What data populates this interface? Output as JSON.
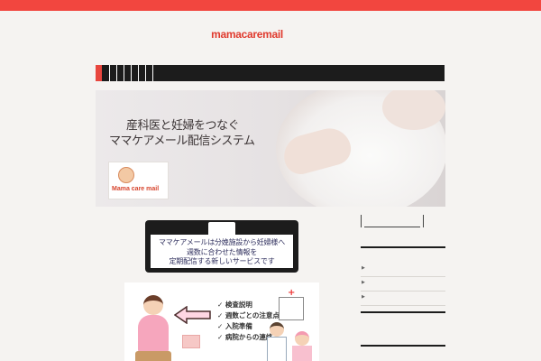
{
  "site": {
    "logo_text": "mamacaremail",
    "brand_color": "#f2463f",
    "nav_color": "#1c1c1c"
  },
  "hero": {
    "headline_line1": "産科医と妊婦をつなぐ",
    "headline_line2": "ママケアメール配信システム",
    "logo_label": "Mama care mail"
  },
  "clipboard": {
    "line1": "ママケアメールは分娩施設から妊婦様へ",
    "line2": "週数に合わせた情報を",
    "line3": "定期配信する新しいサービスです"
  },
  "illustration": {
    "checklist": [
      "✓ 検査説明",
      "✓ 週数ごとの注意点",
      "✓ 入院準備",
      "✓ 病院からの連絡"
    ]
  },
  "sidebar": {
    "bullet_icon": "chevron-right-icon",
    "items": [
      "",
      "",
      ""
    ]
  }
}
